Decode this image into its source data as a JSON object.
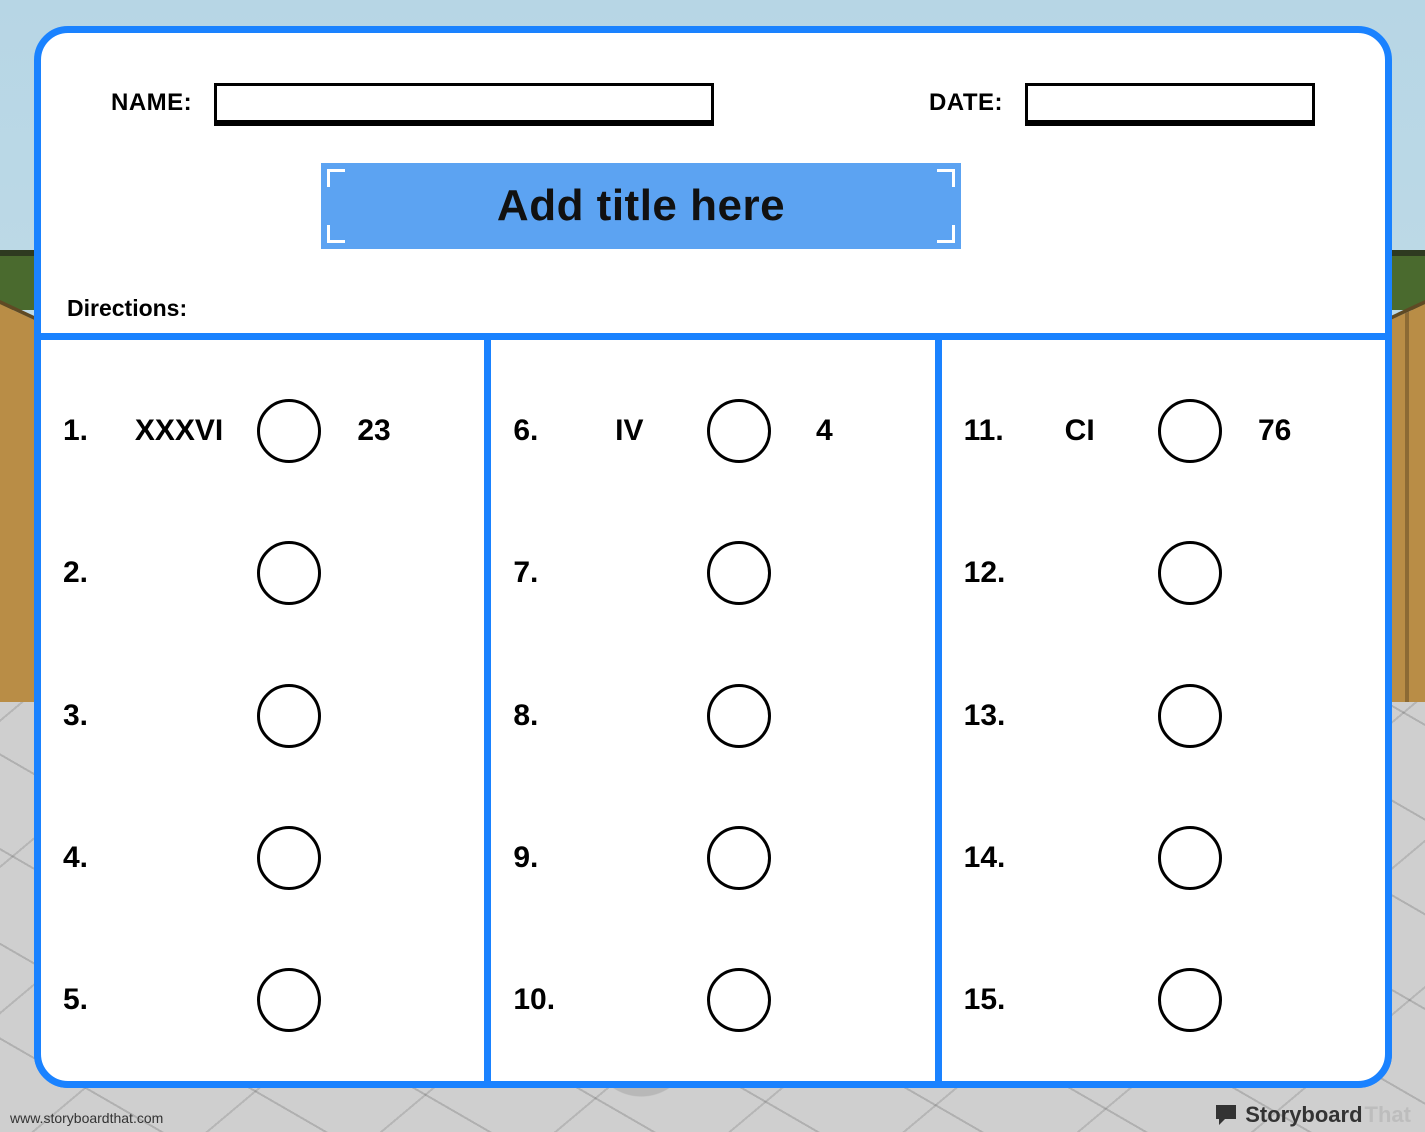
{
  "header": {
    "name_label": "NAME:",
    "date_label": "DATE:"
  },
  "title": "Add title here",
  "directions_label": "Directions:",
  "columns": [
    {
      "items": [
        {
          "n": "1.",
          "roman": "XXXVI",
          "arabic": "23"
        },
        {
          "n": "2.",
          "roman": "",
          "arabic": ""
        },
        {
          "n": "3.",
          "roman": "",
          "arabic": ""
        },
        {
          "n": "4.",
          "roman": "",
          "arabic": ""
        },
        {
          "n": "5.",
          "roman": "",
          "arabic": ""
        }
      ]
    },
    {
      "items": [
        {
          "n": "6.",
          "roman": "IV",
          "arabic": "4"
        },
        {
          "n": "7.",
          "roman": "",
          "arabic": ""
        },
        {
          "n": "8.",
          "roman": "",
          "arabic": ""
        },
        {
          "n": "9.",
          "roman": "",
          "arabic": ""
        },
        {
          "n": "10.",
          "roman": "",
          "arabic": ""
        }
      ]
    },
    {
      "items": [
        {
          "n": "11.",
          "roman": "CI",
          "arabic": "76"
        },
        {
          "n": "12.",
          "roman": "",
          "arabic": ""
        },
        {
          "n": "13.",
          "roman": "",
          "arabic": ""
        },
        {
          "n": "14.",
          "roman": "",
          "arabic": ""
        },
        {
          "n": "15.",
          "roman": "",
          "arabic": ""
        }
      ]
    }
  ],
  "footer": {
    "url": "www.storyboardthat.com",
    "brand_a": "Storyboard",
    "brand_b": "That"
  },
  "colors": {
    "accent": "#1a82ff",
    "title_bg": "#5ca3f2"
  }
}
